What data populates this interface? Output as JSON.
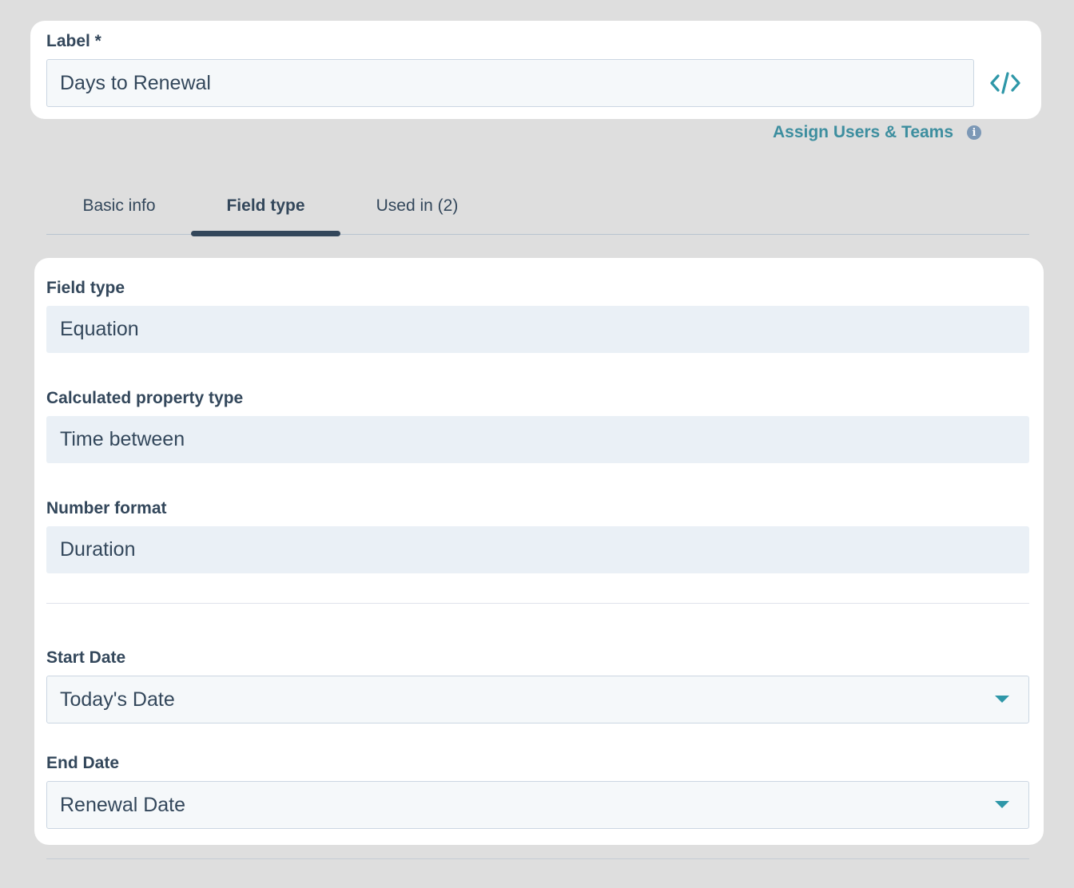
{
  "label_section": {
    "label": "Label *",
    "value": "Days to Renewal",
    "code_icon": "code-icon"
  },
  "assign": {
    "link_text": "Assign Users & Teams",
    "info_icon": "info-icon",
    "info_glyph": "i"
  },
  "tabs": [
    {
      "label": "Basic info",
      "active": false
    },
    {
      "label": "Field type",
      "active": true
    },
    {
      "label": "Used in (2)",
      "active": false
    }
  ],
  "fields": {
    "field_type": {
      "label": "Field type",
      "value": "Equation"
    },
    "calculated_property_type": {
      "label": "Calculated property type",
      "value": "Time between"
    },
    "number_format": {
      "label": "Number format",
      "value": "Duration"
    },
    "start_date": {
      "label": "Start Date",
      "value": "Today's Date",
      "icon": "chevron-down-icon"
    },
    "end_date": {
      "label": "End Date",
      "value": "Renewal Date",
      "icon": "chevron-down-icon"
    }
  },
  "colors": {
    "accent": "#2e97a8",
    "link": "#3d8e9f",
    "text": "#33475b",
    "page_bg": "#dedede"
  }
}
